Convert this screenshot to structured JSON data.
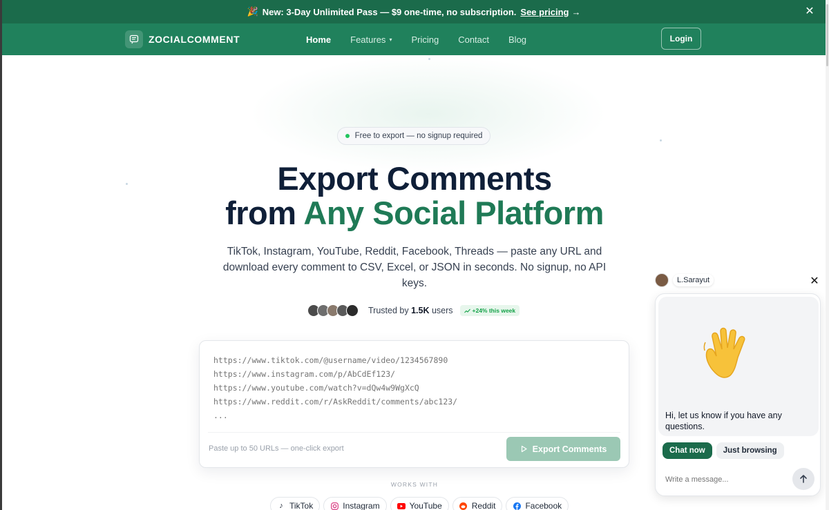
{
  "announcement": {
    "icon": "party-popper-icon",
    "text": "New: 3-Day Unlimited Pass — $9 one-time, no subscription.",
    "link_label": "See pricing",
    "arrow": "→",
    "close": "✕"
  },
  "nav": {
    "brand": "ZOCIALCOMMENT",
    "links": [
      {
        "label": "Home",
        "active": true
      },
      {
        "label": "Features",
        "active": false,
        "has_dropdown": true
      },
      {
        "label": "Pricing",
        "active": false
      },
      {
        "label": "Contact",
        "active": false
      },
      {
        "label": "Blog",
        "active": false
      }
    ],
    "login_label": "Login"
  },
  "hero": {
    "badge": "Free to export — no signup required",
    "title_line1": "Export Comments",
    "title_line2_prefix": "from ",
    "title_line2_accent": "Any Social Platform",
    "subtitle": "TikTok, Instagram, YouTube, Reddit, Facebook, Threads — paste any URL and download every comment to CSV, Excel, or JSON in seconds. No signup, no API keys.",
    "trust_prefix": "Trusted by ",
    "trust_count": "1.5K",
    "trust_suffix": " users",
    "growth": "+24% this week"
  },
  "url_form": {
    "placeholder": "https://www.tiktok.com/@username/video/1234567890\nhttps://www.instagram.com/p/AbCdEf123/\nhttps://www.youtube.com/watch?v=dQw4w9WgXcQ\nhttps://www.reddit.com/r/AskReddit/comments/abc123/\n...",
    "hint": "Paste up to 50 URLs — one-click export",
    "button_label": "Export Comments"
  },
  "works_with": {
    "label": "WORKS WITH",
    "platforms": [
      {
        "name": "TikTok",
        "icon": "tiktok-icon",
        "color": "#000000"
      },
      {
        "name": "Instagram",
        "icon": "instagram-icon",
        "color": "#d62976"
      },
      {
        "name": "YouTube",
        "icon": "youtube-icon",
        "color": "#ff0000"
      },
      {
        "name": "Reddit",
        "icon": "reddit-icon",
        "color": "#ff4500"
      },
      {
        "name": "Facebook",
        "icon": "facebook-icon",
        "color": "#1877f2"
      }
    ]
  },
  "chat": {
    "agent_name": "L.Sarayut",
    "close": "✕",
    "message": "Hi, let us know if you have any questions.",
    "chat_now_label": "Chat now",
    "just_browsing_label": "Just browsing",
    "input_placeholder": "Write a message..."
  },
  "colors": {
    "announce_bg": "#1b6b4b",
    "nav_bg": "#20815c",
    "heading": "#0f1f38",
    "accent": "#1f7a56",
    "export_btn": "#9bc8b4",
    "live_dot": "#22c55e"
  }
}
